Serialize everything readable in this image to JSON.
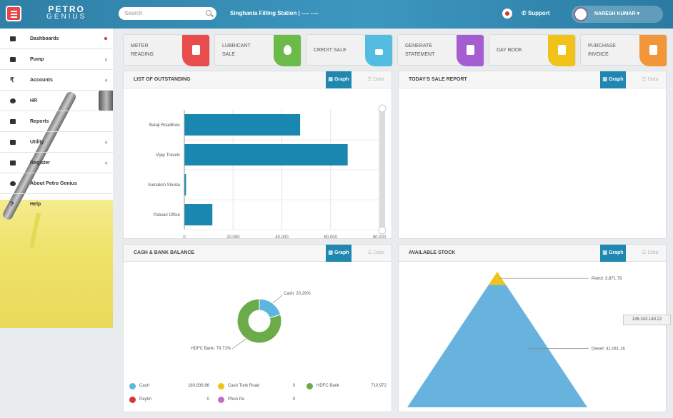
{
  "header": {
    "logo_line1": "PETRO",
    "logo_line2": "GENIUS",
    "search_placeholder": "Search",
    "station": "Singhania Filling Station | ---- ----",
    "support": "Support",
    "user": "NARESH KUMAR"
  },
  "sidebar": {
    "items": [
      {
        "label": "Dashboards",
        "icon": "dashboard-icon"
      },
      {
        "label": "Pump",
        "icon": "pump-icon"
      },
      {
        "label": "Accounts",
        "icon": "rupee-icon"
      },
      {
        "label": "HR",
        "icon": "eye-icon"
      },
      {
        "label": "Reports",
        "icon": "reports-icon"
      },
      {
        "label": "Utility",
        "icon": "utility-icon"
      },
      {
        "label": "Register",
        "icon": "register-icon"
      },
      {
        "label": "About Petro Genius",
        "icon": "info-icon"
      },
      {
        "label": "Help",
        "icon": "help-icon"
      }
    ]
  },
  "quick_actions": [
    {
      "line1": "METER",
      "line2": "READING",
      "color": "#e84c4c"
    },
    {
      "line1": "LUBRICANT",
      "line2": "SALE",
      "color": "#6cbb4a"
    },
    {
      "line1": "CREDIT SALE",
      "line2": "",
      "color": "#52bde0"
    },
    {
      "line1": "GENERATE",
      "line2": "STATEMENT",
      "color": "#a55ed1"
    },
    {
      "line1": "DAY BOOK",
      "line2": "",
      "color": "#f1c21a"
    },
    {
      "line1": "PURCHASE",
      "line2": "INVOICE",
      "color": "#f3963a"
    }
  ],
  "panels": {
    "outstanding": {
      "title": "LIST OF OUTSTANDING",
      "graph": "Graph",
      "data": "Data"
    },
    "todays_sale": {
      "title": "TODAY'S SALE REPORT",
      "graph": "Graph",
      "data": "Data"
    },
    "cash_bank": {
      "title": "CASH & BANK BALANCE",
      "graph": "Graph",
      "data": "Data"
    },
    "stock": {
      "title": "AVAILABLE STOCK",
      "graph": "Graph",
      "data": "Data"
    }
  },
  "chart_data": [
    {
      "type": "bar",
      "orientation": "horizontal",
      "categories": [
        "Balaji Roadlines",
        "Vijay Travels",
        "Sumaksh Shukla",
        "Patwari Office"
      ],
      "values": [
        47500,
        67000,
        700,
        11500
      ],
      "xlim": [
        0,
        80000
      ],
      "xticks": [
        "0",
        "20,000",
        "40,000",
        "60,000",
        "80,000"
      ],
      "grid": true,
      "color": "#1a87b0"
    },
    {
      "type": "pie",
      "donut": true,
      "slices": [
        {
          "label": "Cash: 20.29%",
          "value": 20.29,
          "color": "#5bb7e0"
        },
        {
          "label": "HDFC Bank: 79.71%",
          "value": 79.71,
          "color": "#6cab4a"
        }
      ],
      "legend": [
        {
          "name": "Cash",
          "value": "180,836.86",
          "color": "#5bb7e0"
        },
        {
          "name": "Cash Tonk Road",
          "value": "0",
          "color": "#f1c21a"
        },
        {
          "name": "HDFC Bank",
          "value": "710,972",
          "color": "#6cab4a"
        },
        {
          "name": "Paytm",
          "value": "0",
          "color": "#d8353a"
        },
        {
          "name": "Phon Pe",
          "value": "0",
          "color": "#c66ac6"
        }
      ]
    },
    {
      "type": "pyramid",
      "segments": [
        {
          "label": "Petrol: 3,871.79",
          "value": 3871.79,
          "color": "#f1c21a"
        },
        {
          "label": "Diesel: 41,041.16",
          "value": 41041.16,
          "color": "#68b3dd"
        }
      ],
      "tooltip": "136.243.149.22"
    }
  ]
}
